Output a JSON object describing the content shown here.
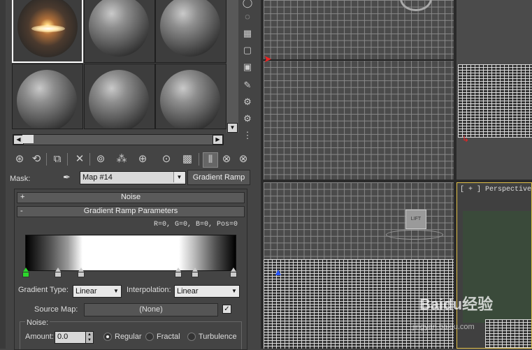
{
  "material_editor": {
    "slot_icons": [
      "sphere-icon",
      "backlight-icon",
      "checker-bg-icon",
      "sample-uv-icon",
      "video-color-icon",
      "make-preview-icon",
      "options-icon",
      "select-by-material-icon",
      "material-navigator-icon"
    ],
    "toolbar_icons": [
      "get-material-icon",
      "put-to-scene-icon",
      "assign-material-icon",
      "reset-map-icon",
      "make-copy-icon",
      "make-unique-icon",
      "put-to-library-icon",
      "material-id-icon",
      "show-in-viewport-icon",
      "show-end-result-icon",
      "go-to-parent-icon",
      "go-forward-sibling-icon"
    ],
    "mask_label": "Mask:",
    "map_name": "Map #14",
    "map_type_button": "Gradient Ramp",
    "rollouts": {
      "noise": {
        "sign": "+",
        "title": "Noise"
      },
      "gradient": {
        "sign": "-",
        "title": "Gradient Ramp Parameters"
      }
    },
    "rgb_readout": "R=0, G=0, B=0,  Pos=0",
    "gradient_type_label": "Gradient Type:",
    "gradient_type_value": "Linear",
    "interpolation_label": "Interpolation:",
    "interpolation_value": "Linear",
    "source_map_label": "Source Map:",
    "source_map_value": "(None)",
    "source_map_checked": true,
    "noise_group_label": "Noise:",
    "amount_label": "Amount:",
    "amount_value": "0.0",
    "noise_types": [
      {
        "label": "Regular",
        "selected": true
      },
      {
        "label": "Fractal",
        "selected": false
      },
      {
        "label": "Turbulence",
        "selected": false
      }
    ]
  },
  "viewports": {
    "perspective_label": "[ + ] Perspective",
    "camera_label": "LIFT"
  },
  "watermark": {
    "text": "Baidu经验",
    "url": "jingyan.baidu.com"
  }
}
